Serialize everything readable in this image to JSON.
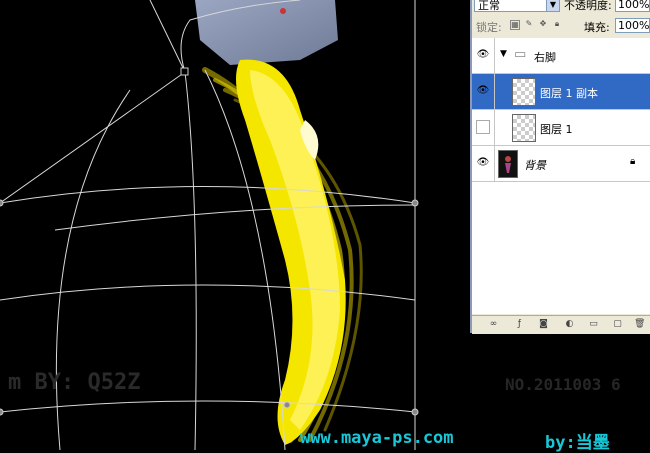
{
  "layers_panel": {
    "blend_mode": "正常",
    "opacity_label": "不透明度:",
    "opacity_value": "100%",
    "lock_label": "锁定:",
    "fill_label": "填充:",
    "fill_value": "100%",
    "layers": [
      {
        "name": "右脚",
        "type": "group",
        "visible": true,
        "selected": false
      },
      {
        "name": "图层 1 副本",
        "type": "layer",
        "visible": true,
        "selected": true
      },
      {
        "name": "图层 1",
        "type": "layer",
        "visible": false,
        "selected": false
      },
      {
        "name": "背景",
        "type": "background",
        "visible": true,
        "selected": false
      }
    ]
  },
  "canvas": {
    "watermark_left": "m   BY: Q52Z",
    "watermark_right": "NO.2011003  6",
    "footer_url": "www.maya-ps.com",
    "footer_author": "by:当墨",
    "accent_yellow": "#f5e600",
    "footer_color": "#18c8d8"
  }
}
